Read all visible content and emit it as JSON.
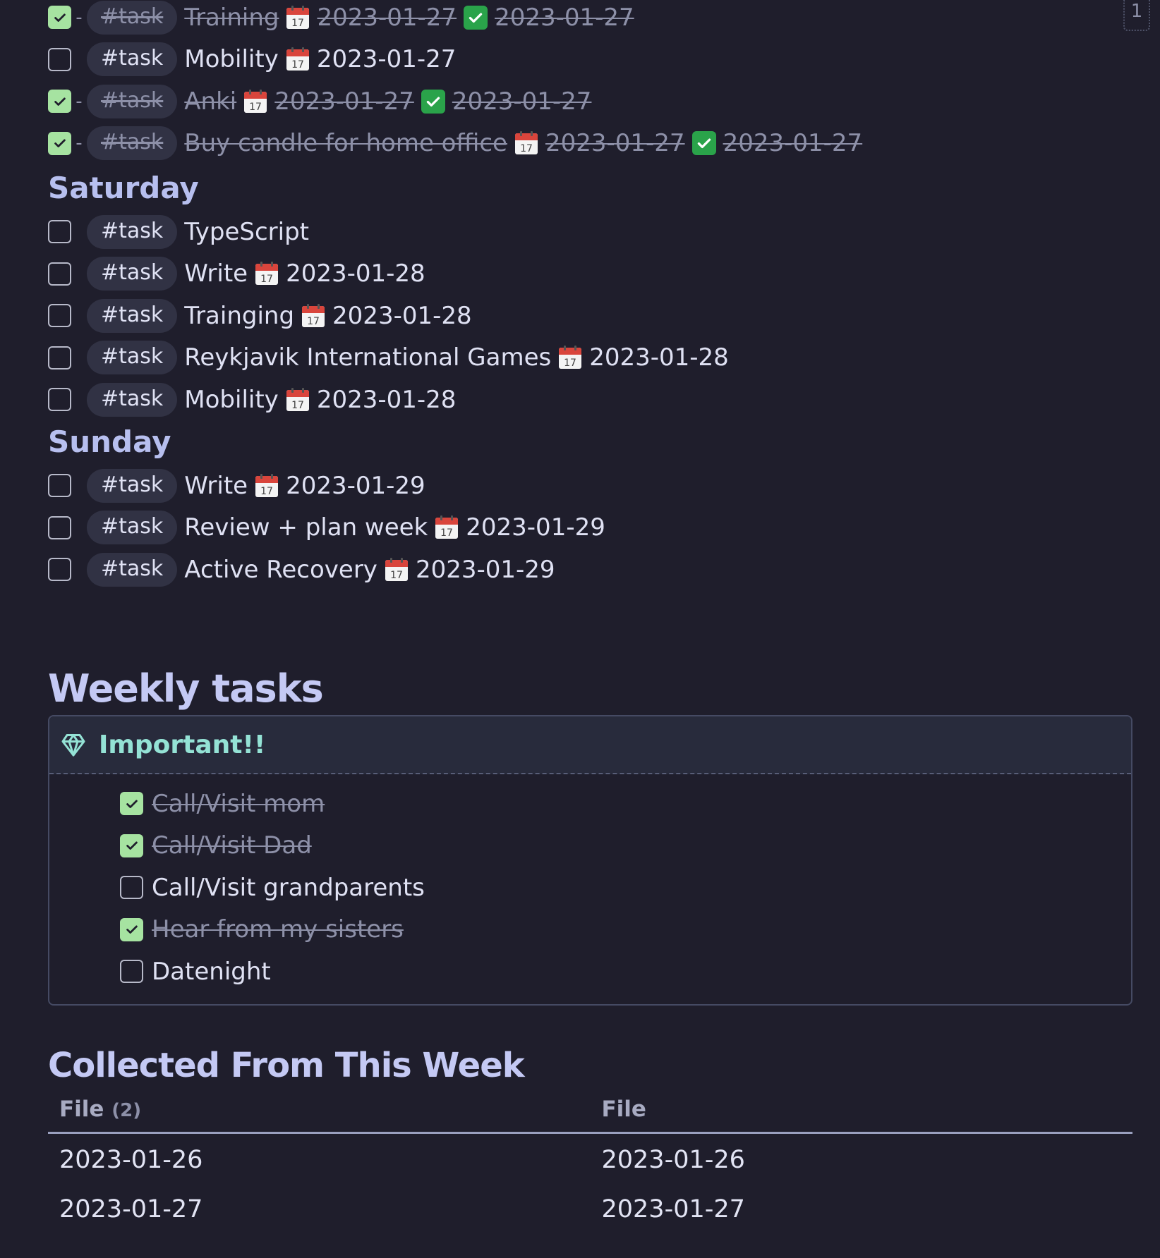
{
  "page_indicator": "1",
  "tag_label": "#task",
  "top_tasks": [
    {
      "title": "Training",
      "due": "2023-01-27",
      "completed_on": "2023-01-27",
      "done": true
    },
    {
      "title": "Mobility",
      "due": "2023-01-27",
      "done": false
    },
    {
      "title": "Anki",
      "due": "2023-01-27",
      "completed_on": "2023-01-27",
      "done": true
    },
    {
      "title": "Buy candle for home office",
      "due": "2023-01-27",
      "completed_on": "2023-01-27",
      "done": true
    }
  ],
  "saturday": {
    "heading": "Saturday",
    "tasks": [
      {
        "title": "TypeScript",
        "done": false
      },
      {
        "title": "Write",
        "due": "2023-01-28",
        "done": false
      },
      {
        "title": "Trainging",
        "due": "2023-01-28",
        "done": false
      },
      {
        "title": "Reykjavik International Games",
        "due": "2023-01-28",
        "done": false
      },
      {
        "title": "Mobility",
        "due": "2023-01-28",
        "done": false
      }
    ]
  },
  "sunday": {
    "heading": "Sunday",
    "tasks": [
      {
        "title": "Write",
        "due": "2023-01-29",
        "done": false
      },
      {
        "title": "Review + plan week",
        "due": "2023-01-29",
        "done": false
      },
      {
        "title": "Active Recovery",
        "due": "2023-01-29",
        "done": false
      }
    ]
  },
  "weekly": {
    "heading": "Weekly tasks",
    "callout_title": "Important!!",
    "callout_icon": "gem-icon",
    "tasks": [
      {
        "title": "Call/Visit mom",
        "done": true
      },
      {
        "title": "Call/Visit Dad",
        "done": true
      },
      {
        "title": "Call/Visit grandparents",
        "done": false
      },
      {
        "title": "Hear from my sisters",
        "done": true
      },
      {
        "title": "Datenight",
        "done": false
      }
    ]
  },
  "collected": {
    "heading": "Collected From This Week",
    "columns": [
      {
        "label": "File",
        "count": "(2)"
      },
      {
        "label": "File",
        "count": ""
      }
    ],
    "rows": [
      [
        "2023-01-26",
        "2023-01-26"
      ],
      [
        "2023-01-27",
        "2023-01-27"
      ]
    ]
  },
  "colors": {
    "background": "#1f1e2c",
    "checked": "#a6e3a1",
    "callout_title": "#94e2d5",
    "heading": "#b7bfef",
    "done_text": "#8d90a8"
  }
}
